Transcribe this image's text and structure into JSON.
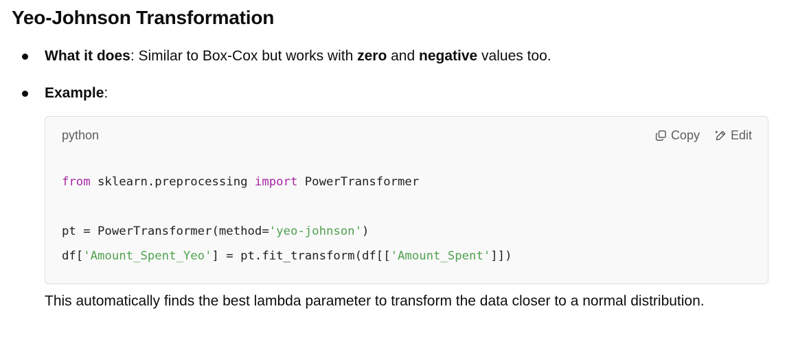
{
  "heading": "Yeo-Johnson Transformation",
  "bullets": [
    {
      "label": "What it does",
      "text_a": ": Similar to Box-Cox but works with ",
      "bold_a": "zero",
      "text_b": " and ",
      "bold_b": "negative",
      "text_c": " values too."
    },
    {
      "label": "Example",
      "text_a": ":"
    }
  ],
  "code_block": {
    "language": "python",
    "copy_label": "Copy",
    "edit_label": "Edit",
    "copy_icon": "copy-icon",
    "edit_icon": "pencil-icon",
    "lines": [
      {
        "t1": "from",
        "t2": " sklearn.preprocessing ",
        "t3": "import",
        "t4": " PowerTransformer"
      },
      {
        "t1": "pt = PowerTransformer(method=",
        "t2": "'yeo-johnson'",
        "t3": ")"
      },
      {
        "t1": "df[",
        "t2": "'Amount_Spent_Yeo'",
        "t3": "] = pt.fit_transform(df[[",
        "t4": "'Amount_Spent'",
        "t5": "]])"
      }
    ],
    "colors": {
      "keyword": "#a626a4",
      "string": "#50a14f",
      "background": "#f9f9f9"
    }
  },
  "paragraph": "This automatically finds the best lambda parameter to transform the data closer to a normal distribution."
}
